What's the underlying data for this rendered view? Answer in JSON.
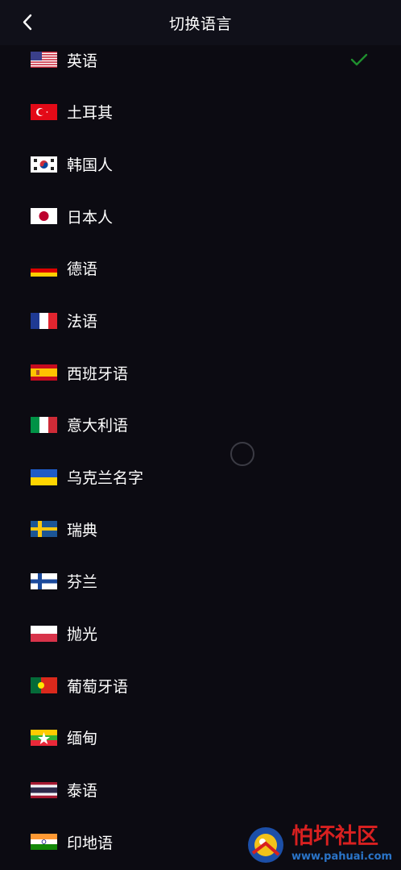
{
  "header": {
    "title": "切换语言"
  },
  "languages": [
    {
      "label": "英语",
      "flag": "us-flag",
      "selected": true
    },
    {
      "label": "土耳其",
      "flag": "turkey-flag",
      "selected": false
    },
    {
      "label": "韩国人",
      "flag": "south-korea-flag",
      "selected": false
    },
    {
      "label": "日本人",
      "flag": "japan-flag",
      "selected": false
    },
    {
      "label": "德语",
      "flag": "germany-flag",
      "selected": false
    },
    {
      "label": "法语",
      "flag": "france-flag",
      "selected": false
    },
    {
      "label": "西班牙语",
      "flag": "spain-flag",
      "selected": false
    },
    {
      "label": "意大利语",
      "flag": "italy-flag",
      "selected": false
    },
    {
      "label": "乌克兰名字",
      "flag": "ukraine-flag",
      "selected": false
    },
    {
      "label": "瑞典",
      "flag": "sweden-flag",
      "selected": false
    },
    {
      "label": "芬兰",
      "flag": "finland-flag",
      "selected": false
    },
    {
      "label": "抛光",
      "flag": "poland-flag",
      "selected": false
    },
    {
      "label": "葡萄牙语",
      "flag": "portugal-flag",
      "selected": false
    },
    {
      "label": "缅甸",
      "flag": "myanmar-flag",
      "selected": false
    },
    {
      "label": "泰语",
      "flag": "thailand-flag",
      "selected": false
    },
    {
      "label": "印地语",
      "flag": "india-flag",
      "selected": false
    }
  ],
  "colors": {
    "background": "#0c0b12",
    "header": "#101019",
    "check": "#1f8f2e",
    "text": "#ffffff"
  },
  "watermark": {
    "title": "怕坏社区",
    "url": "www.pahuai.com"
  }
}
